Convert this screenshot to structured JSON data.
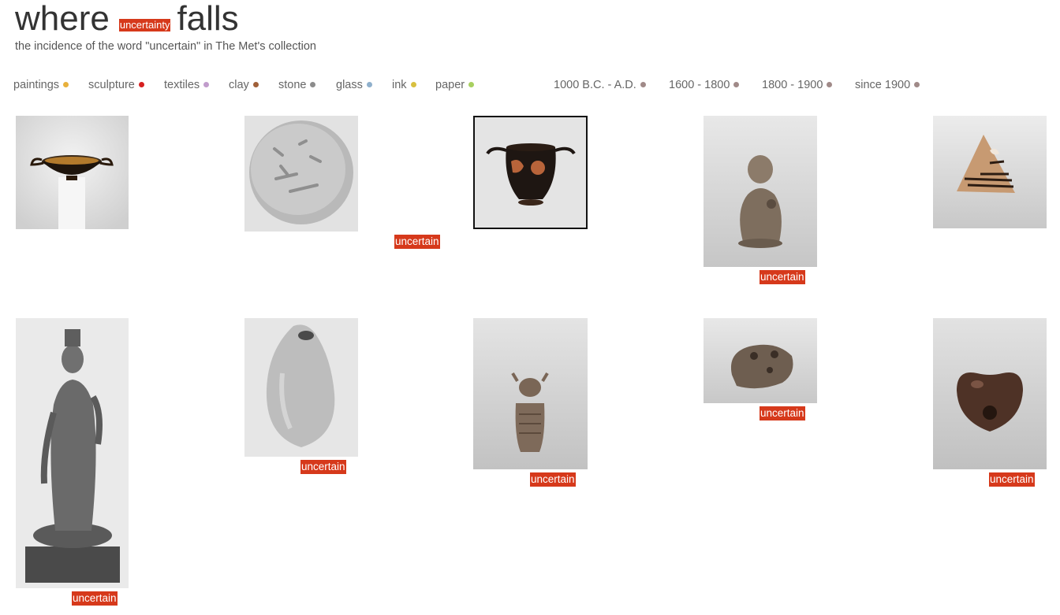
{
  "header": {
    "title_start": "where",
    "title_tag": "uncertainty",
    "title_end": "falls",
    "subtitle": "the incidence of the word \"uncertain\" in The Met's collection"
  },
  "filters": {
    "materials": [
      {
        "label": "paintings",
        "color": "#e8b13c"
      },
      {
        "label": "sculpture",
        "color": "#d62020"
      },
      {
        "label": "textiles",
        "color": "#c19ccc"
      },
      {
        "label": "clay",
        "color": "#a0603a"
      },
      {
        "label": "stone",
        "color": "#8c8c8c"
      },
      {
        "label": "glass",
        "color": "#8fb0cc"
      },
      {
        "label": "ink",
        "color": "#d8c040"
      },
      {
        "label": "paper",
        "color": "#a8d060"
      }
    ],
    "periods": [
      {
        "label": "1000 B.C. - A.D.",
        "color": "#a08a88"
      },
      {
        "label": "1600 - 1800",
        "color": "#a08a88"
      },
      {
        "label": "1800 - 1900",
        "color": "#a08a88"
      },
      {
        "label": "since 1900",
        "color": "#a08a88"
      }
    ]
  },
  "grid": {
    "uncertain_label": "uncertain",
    "items": [
      {
        "name": "kylix-black-cup",
        "caption": ""
      },
      {
        "name": "stone-tablet-relief",
        "caption": ""
      },
      {
        "name": "red-figure-vessel",
        "caption": "uncertain"
      },
      {
        "name": "clay-figurine",
        "caption": "uncertain"
      },
      {
        "name": "painted-pottery-shard",
        "caption": ""
      },
      {
        "name": "standing-bodhisattva-statue",
        "caption": "uncertain"
      },
      {
        "name": "gourd-shaped-vessel",
        "caption": "uncertain"
      },
      {
        "name": "small-clay-idol",
        "caption": "uncertain"
      },
      {
        "name": "clay-ocarina-animal",
        "caption": "uncertain"
      },
      {
        "name": "dark-clay-whistle",
        "caption": "uncertain"
      }
    ]
  }
}
